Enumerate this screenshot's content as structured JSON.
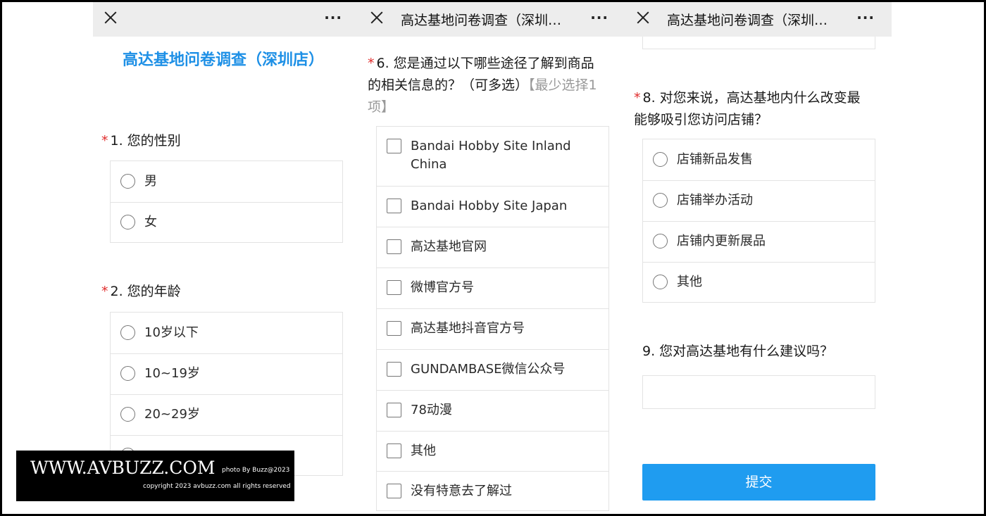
{
  "topbar": {
    "title": "高达基地问卷调查（深圳…",
    "more": "···"
  },
  "survey_title": "高达基地问卷调查（深圳店）",
  "q1": {
    "label": "1. 您的性别",
    "options": [
      "男",
      "女"
    ]
  },
  "q2": {
    "label": "2. 您的年龄",
    "options": [
      "10岁以下",
      "10~19岁",
      "20~29岁"
    ]
  },
  "q6": {
    "label": "6. 您是通过以下哪些途径了解到商品的相关信息的？（可多选）",
    "hint": "【最少选择1项】",
    "options": [
      "Bandai Hobby Site Inland China",
      "Bandai Hobby Site Japan",
      "高达基地官网",
      "微博官方号",
      "高达基地抖音官方号",
      "GUNDAMBASE微信公众号",
      "78动漫",
      "其他",
      "没有特意去了解过"
    ]
  },
  "q8": {
    "label": "8. 对您来说，高达基地内什么改变最能够吸引您访问店铺？",
    "options": [
      "店铺新品发售",
      "店铺举办活动",
      "店铺内更新展品",
      "其他"
    ]
  },
  "q9": {
    "label": "9. 您对高达基地有什么建议吗？"
  },
  "submit_label": "提交",
  "required_mark": "*",
  "watermark": {
    "main": "WWW.AVBUZZ.COM",
    "photo": "photo By Buzz@2023",
    "copyright": "copyright 2023 avbuzz.com all rights reserved"
  }
}
